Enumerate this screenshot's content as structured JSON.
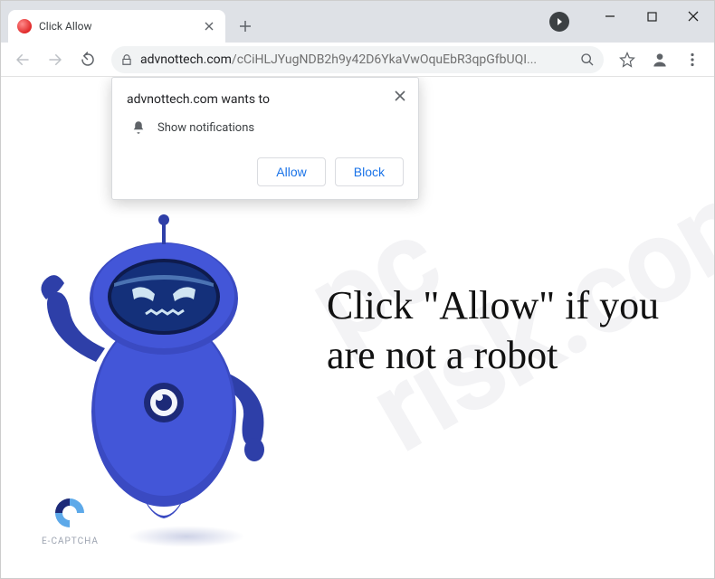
{
  "tab": {
    "title": "Click Allow"
  },
  "url": {
    "domain": "advnottech.com",
    "path": "/cCiHLJYugNDB2h9y42D6YkaVwOquEbR3qpGfbUQI..."
  },
  "permission": {
    "title": "advnottech.com wants to",
    "label": "Show notifications",
    "allow": "Allow",
    "block": "Block"
  },
  "page": {
    "message": "Click \"Allow\" if you are not a robot",
    "ecaptcha": "E-CAPTCHA"
  },
  "watermark": {
    "line1": "pc",
    "line2": "risk.com"
  }
}
